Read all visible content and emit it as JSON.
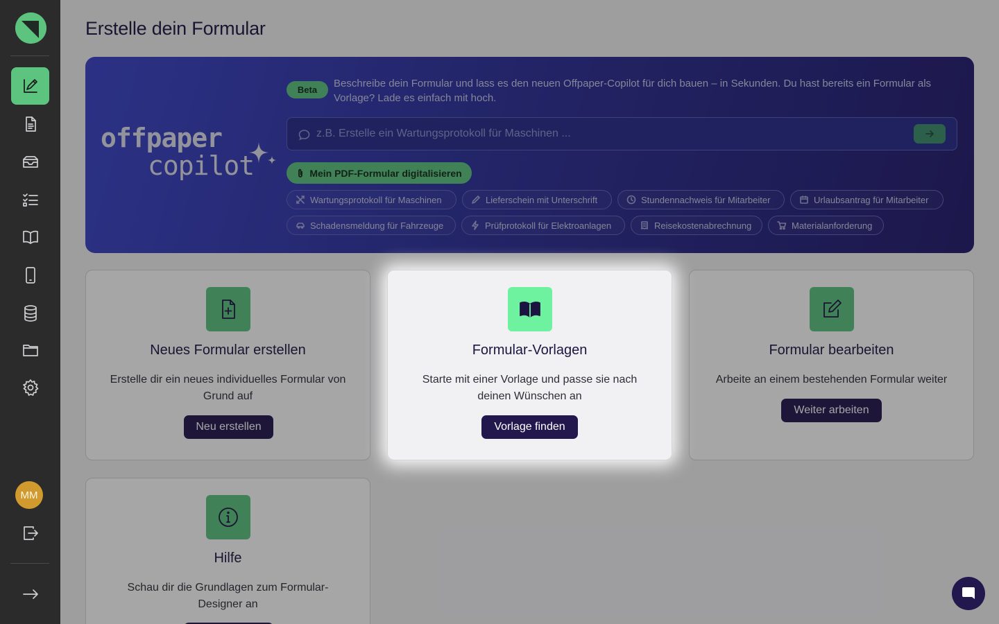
{
  "sidebar": {
    "items": [
      {
        "name": "form-editor",
        "icon": "form-editor-icon",
        "active": true
      },
      {
        "name": "documents",
        "icon": "document-icon"
      },
      {
        "name": "inbox",
        "icon": "inbox-icon"
      },
      {
        "name": "checklists",
        "icon": "checklist-icon"
      },
      {
        "name": "guide",
        "icon": "book-icon"
      },
      {
        "name": "mobile",
        "icon": "mobile-icon"
      },
      {
        "name": "database",
        "icon": "database-icon"
      },
      {
        "name": "folders",
        "icon": "folder-icon"
      },
      {
        "name": "settings",
        "icon": "gear-icon"
      }
    ],
    "avatar_initials": "MM"
  },
  "page": {
    "title": "Erstelle dein Formular"
  },
  "hero": {
    "logo_line1": "offpaper",
    "logo_line2": "copilot",
    "badge": "Beta",
    "description": "Beschreibe dein Formular und lass es den neuen Offpaper-Copilot für dich bauen – in Sekunden. Du hast bereits ein Formular als Vorlage? Lade es einfach mit hoch.",
    "input_placeholder": "z.B. Erstelle ein Wartungsprotokoll für Maschinen ...",
    "pdf_button": "Mein PDF-Formular digitalisieren",
    "chips": [
      {
        "label": "Wartungsprotokoll für Maschinen",
        "icon": "tools-icon"
      },
      {
        "label": "Lieferschein mit Unterschrift",
        "icon": "pen-icon"
      },
      {
        "label": "Stundennachweis für Mitarbeiter",
        "icon": "clock-icon"
      },
      {
        "label": "Urlaubsantrag für Mitarbeiter",
        "icon": "calendar-icon"
      },
      {
        "label": "Schadensmeldung für Fahrzeuge",
        "icon": "car-icon"
      },
      {
        "label": "Prüfprotokoll für Elektroanlagen",
        "icon": "lightning-icon"
      },
      {
        "label": "Reisekostenabrechnung",
        "icon": "receipt-icon"
      },
      {
        "label": "Materialanforderung",
        "icon": "cart-icon"
      }
    ]
  },
  "cards": [
    {
      "title": "Neues Formular erstellen",
      "text": "Erstelle dir ein neues individuelles Formular von Grund auf",
      "button": "Neu erstellen",
      "icon": "file-plus-icon"
    },
    {
      "title": "Formular-Vorlagen",
      "text": "Starte mit einer Vorlage und passe sie nach deinen Wünschen an",
      "button": "Vorlage finden",
      "icon": "book-open-icon",
      "highlighted": true
    },
    {
      "title": "Formular bearbeiten",
      "text": "Arbeite an einem bestehenden Formular weiter",
      "button": "Weiter arbeiten",
      "icon": "edit-icon"
    },
    {
      "title": "Hilfe",
      "text": "Schau dir die Grundlagen zum Formular-Designer an",
      "icon": "info-icon"
    }
  ],
  "colors": {
    "accent_green": "#5cc47f",
    "dark_navy": "#22184e",
    "sidebar_bg": "#2b2b2c",
    "hero_gradient_start": "#3a43c9",
    "hero_gradient_end": "#221a6b"
  }
}
